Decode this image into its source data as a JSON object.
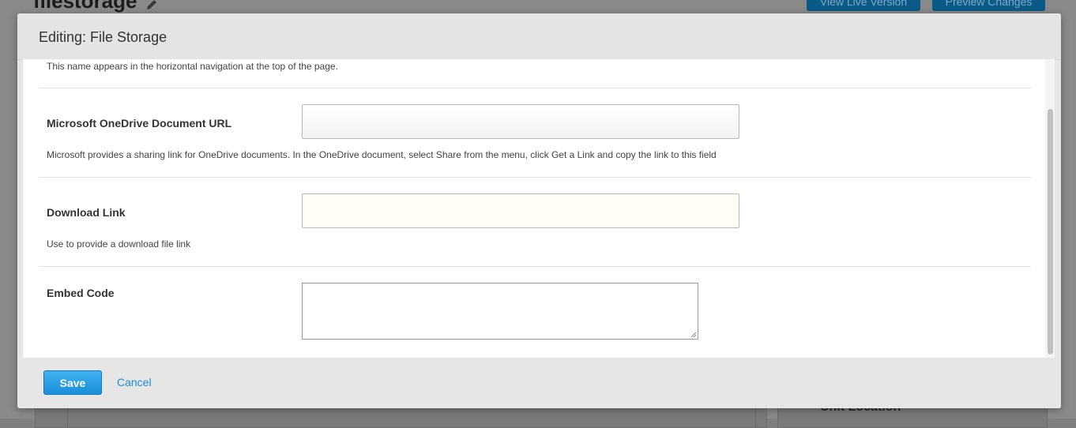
{
  "background": {
    "page_title": "filestorage",
    "view_live_label": "View Live Version",
    "preview_label": "Preview Changes",
    "right_panel_heading": "Unit Location"
  },
  "modal": {
    "title": "Editing: File Storage",
    "top_help": "This name appears in the horizontal navigation at the top of the page.",
    "fields": [
      {
        "label": "Microsoft OneDrive Document URL",
        "value": "",
        "help": "Microsoft provides a sharing link for OneDrive documents. In the OneDrive document, select Share from the menu, click Get a Link and copy the link to this field"
      },
      {
        "label": "Download Link",
        "value": "",
        "help": "Use to provide a download file link"
      },
      {
        "label": "Embed Code",
        "value": ""
      }
    ],
    "save_label": "Save",
    "cancel_label": "Cancel"
  },
  "colors": {
    "accent": "#1a8fd8",
    "overlay": "#7f7f7f"
  }
}
